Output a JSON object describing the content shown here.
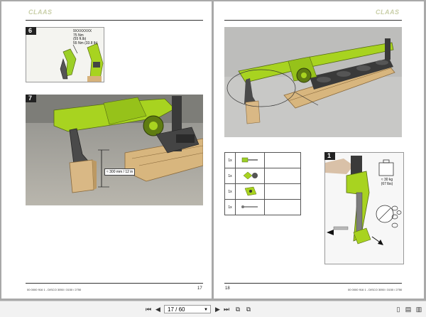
{
  "viewer": {
    "page_field": "17 / 60",
    "current_page": 17,
    "total_pages": 60
  },
  "left_page": {
    "logo": "CLAAS",
    "figure6": {
      "label": "6",
      "callout_lines": [
        "9XXXXXXX",
        "75 Nm",
        "(55 ft.lb)",
        "55 Nm (33.8 lb)"
      ]
    },
    "figure7": {
      "label": "7",
      "dimension": "≈ 300 mm / 12 in"
    },
    "footer_doc": "00 0000 916 1 - DISCO 3050 / 3150 / 2750",
    "page_number": "17"
  },
  "right_page": {
    "logo": "CLAAS",
    "parts_table": [
      {
        "qty": "1x",
        "icon": "bolt-icon"
      },
      {
        "qty": "1x",
        "icon": "nut-washer-icon"
      },
      {
        "qty": "1x",
        "icon": "bracket-icon"
      },
      {
        "qty": "1x",
        "icon": "pin-icon"
      }
    ],
    "figure1": {
      "label": "1",
      "weight": "≈ 30 kg",
      "weight_imperial": "(67 lbs)"
    },
    "page_number": "18",
    "footer_doc": "00 0000 916 1 - DISCO 3050 / 3150 / 2750"
  },
  "colors": {
    "machine_green": "#a8d320",
    "background_gray": "#a9a9a9",
    "logo_tint": "#c9cfa8"
  }
}
